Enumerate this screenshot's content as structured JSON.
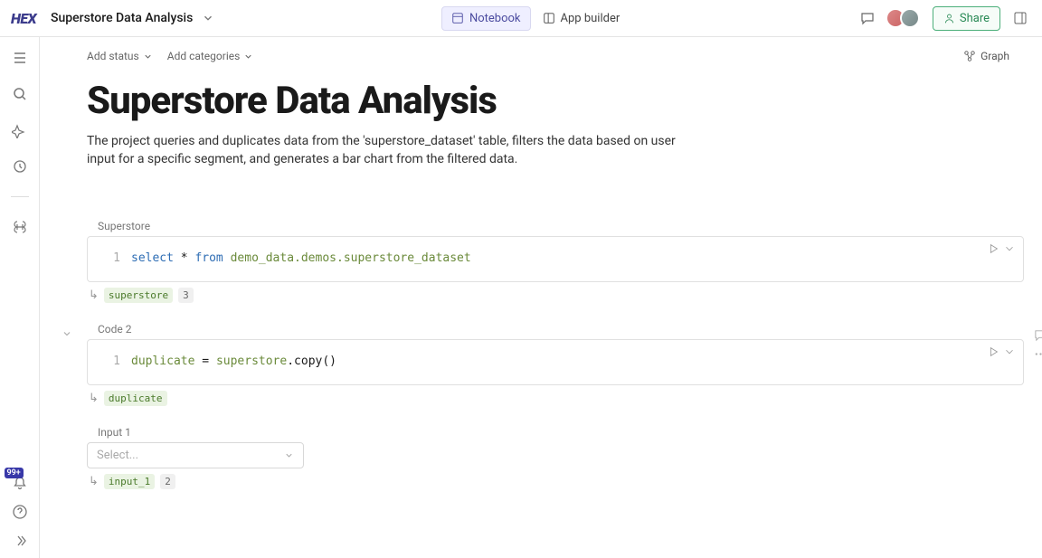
{
  "header": {
    "logo": "HEX",
    "title": "Superstore Data Analysis",
    "tabs": {
      "notebook": "Notebook",
      "app_builder": "App builder"
    },
    "share": "Share"
  },
  "sidebar_notif": "99+",
  "meta": {
    "add_status": "Add status",
    "add_categories": "Add categories",
    "graph": "Graph"
  },
  "page": {
    "title": "Superstore Data Analysis",
    "description": "The project queries and duplicates data from the 'superstore_dataset' table, filters the data based on user input for a specific segment, and generates a bar chart from the filtered data."
  },
  "cells": [
    {
      "label": "Superstore",
      "line_no": "1",
      "code_html": "<span class='kw'>select</span> * <span class='kw'>from</span> <span class='tbl'>demo_data.demos.superstore_dataset</span>",
      "output_tag": "superstore",
      "output_count": "3"
    },
    {
      "label": "Code 2",
      "line_no": "1",
      "code_html": "<span class='var'>duplicate</span> = <span class='var'>superstore</span>.copy()",
      "output_tag": "duplicate",
      "output_count": null
    }
  ],
  "input_cell": {
    "label": "Input 1",
    "placeholder": "Select...",
    "output_tag": "input_1",
    "output_count": "2"
  }
}
